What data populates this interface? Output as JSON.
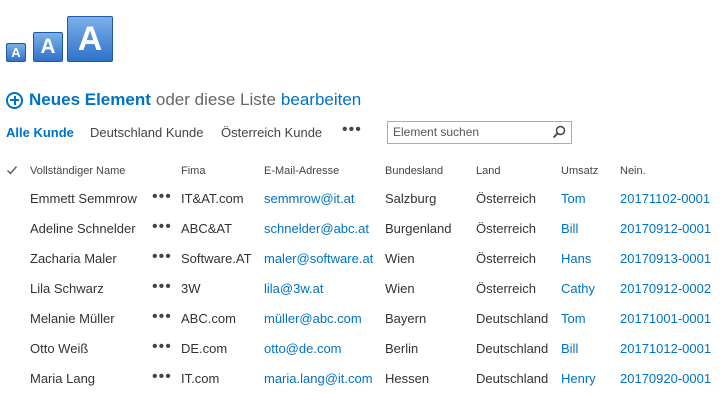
{
  "text_size_icons": [
    "A",
    "A",
    "A"
  ],
  "toolbar": {
    "new_item_label": "Neues Element",
    "connector": "oder diese Liste",
    "edit_link": "bearbeiten"
  },
  "views": {
    "items": [
      "Alle Kunde",
      "Deutschland Kunde",
      "Österreich Kunde"
    ],
    "active": "Alle Kunde",
    "more": "•••"
  },
  "search": {
    "placeholder": "Element suchen"
  },
  "table": {
    "columns": [
      "Vollständiger Name",
      "Fima",
      "E-Mail-Adresse",
      "Bundesland",
      "Land",
      "Umsatz",
      "Nein."
    ],
    "row_menu": "•••",
    "rows": [
      {
        "name": "Emmett Semmrow",
        "fima": "IT&AT.com",
        "email": "semmrow@it.at",
        "bundesland": "Salzburg",
        "land": "Österreich",
        "umsatz": "Tom",
        "nein": "20171102-0001"
      },
      {
        "name": "Adeline Schnelder",
        "fima": "ABC&AT",
        "email": "schnelder@abc.at",
        "bundesland": "Burgenland",
        "land": "Österreich",
        "umsatz": "Bill",
        "nein": "20170912-0001"
      },
      {
        "name": "Zacharia Maler",
        "fima": "Software.AT",
        "email": "maler@software.at",
        "bundesland": "Wien",
        "land": "Österreich",
        "umsatz": "Hans",
        "nein": "20170913-0001"
      },
      {
        "name": "Lila Schwarz",
        "fima": "3W",
        "email": "lila@3w.at",
        "bundesland": "Wien",
        "land": "Österreich",
        "umsatz": "Cathy",
        "nein": "20170912-0002"
      },
      {
        "name": "Melanie Müller",
        "fima": "ABC.com",
        "email": "müller@abc.com",
        "bundesland": "Bayern",
        "land": "Deutschland",
        "umsatz": "Tom",
        "nein": "20171001-0001"
      },
      {
        "name": "Otto Weiß",
        "fima": "DE.com",
        "email": "otto@de.com",
        "bundesland": "Berlin",
        "land": "Deutschland",
        "umsatz": "Bill",
        "nein": "20171012-0001"
      },
      {
        "name": "Maria Lang",
        "fima": "IT.com",
        "email": "maria.lang@it.com",
        "bundesland": "Hessen",
        "land": "Deutschland",
        "umsatz": "Henry",
        "nein": "20170920-0001"
      }
    ]
  },
  "colors": {
    "accent": "#0072c6",
    "icon_gradient_top": "#7bb0ea",
    "icon_gradient_bottom": "#2f72c9"
  }
}
